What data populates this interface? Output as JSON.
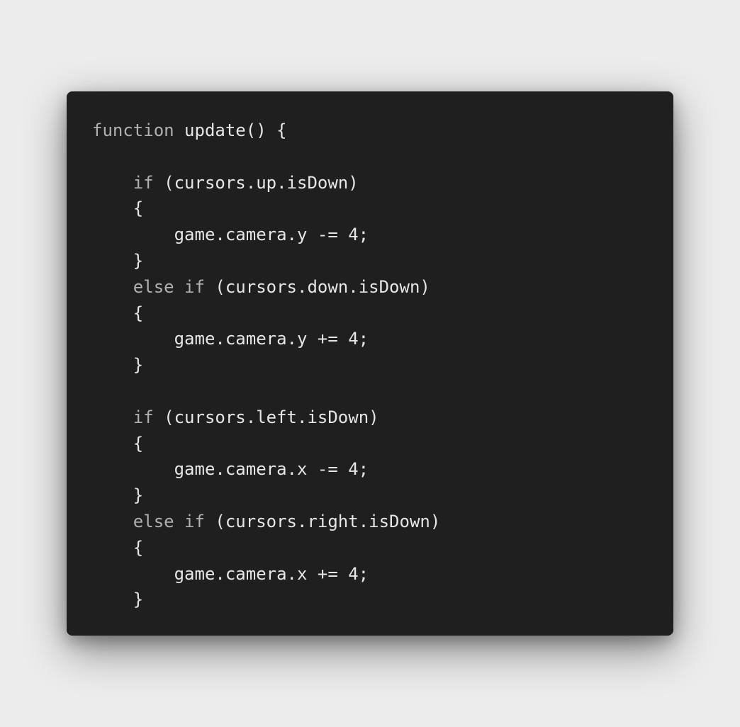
{
  "code": {
    "lines": [
      {
        "kw": "function",
        "text": " update() {",
        "indent": ""
      },
      {
        "kw": "",
        "text": "",
        "indent": ""
      },
      {
        "kw": "if",
        "text": " (cursors.up.isDown)",
        "indent": "    "
      },
      {
        "kw": "",
        "text": "{",
        "indent": "    "
      },
      {
        "kw": "",
        "text": "game.camera.y -= 4;",
        "indent": "        "
      },
      {
        "kw": "",
        "text": "}",
        "indent": "    "
      },
      {
        "kw": "else if",
        "text": " (cursors.down.isDown)",
        "indent": "    "
      },
      {
        "kw": "",
        "text": "{",
        "indent": "    "
      },
      {
        "kw": "",
        "text": "game.camera.y += 4;",
        "indent": "        "
      },
      {
        "kw": "",
        "text": "}",
        "indent": "    "
      },
      {
        "kw": "",
        "text": "",
        "indent": ""
      },
      {
        "kw": "if",
        "text": " (cursors.left.isDown)",
        "indent": "    "
      },
      {
        "kw": "",
        "text": "{",
        "indent": "    "
      },
      {
        "kw": "",
        "text": "game.camera.x -= 4;",
        "indent": "        "
      },
      {
        "kw": "",
        "text": "}",
        "indent": "    "
      },
      {
        "kw": "else if",
        "text": " (cursors.right.isDown)",
        "indent": "    "
      },
      {
        "kw": "",
        "text": "{",
        "indent": "    "
      },
      {
        "kw": "",
        "text": "game.camera.x += 4;",
        "indent": "        "
      },
      {
        "kw": "",
        "text": "}",
        "indent": "    "
      }
    ]
  },
  "colors": {
    "background": "#ececec",
    "panel": "#1f1f1f",
    "keyword": "#b0b0b0",
    "text": "#e6e6e6"
  }
}
